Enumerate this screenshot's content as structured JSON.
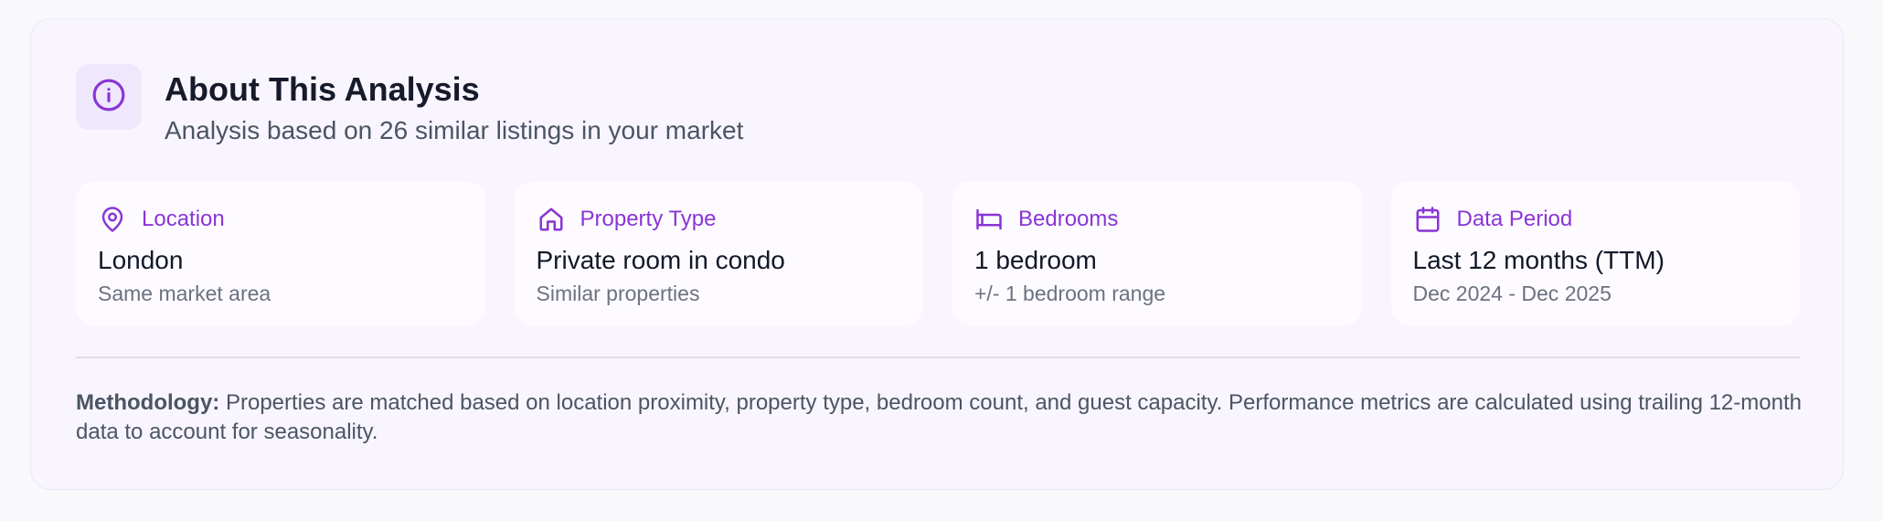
{
  "header": {
    "icon": "info-icon",
    "title": "About This Analysis",
    "subtitle": "Analysis based on 26 similar listings in your market"
  },
  "cards": [
    {
      "icon": "map-pin-icon",
      "label": "Location",
      "value": "London",
      "sub": "Same market area"
    },
    {
      "icon": "home-icon",
      "label": "Property Type",
      "value": "Private room in condo",
      "sub": "Similar properties"
    },
    {
      "icon": "bed-icon",
      "label": "Bedrooms",
      "value": "1 bedroom",
      "sub": "+/- 1 bedroom range"
    },
    {
      "icon": "calendar-icon",
      "label": "Data Period",
      "value": "Last 12 months (TTM)",
      "sub": "Dec 2024 - Dec 2025"
    }
  ],
  "methodology": {
    "label": "Methodology:",
    "text": " Properties are matched based on location proximity, property type, bedroom count, and guest capacity. Performance metrics are calculated using trailing 12-month data to account for seasonality."
  },
  "colors": {
    "accent": "#8a35d6",
    "panel_bg": "#f8f5fe",
    "card_bg": "#fdfbff"
  }
}
